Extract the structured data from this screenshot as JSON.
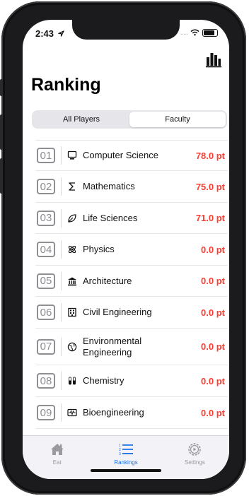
{
  "status": {
    "time": "2:43",
    "carrier": "....."
  },
  "header": {
    "title": "Ranking"
  },
  "tabs_segment": [
    {
      "label": "All Players",
      "selected": false
    },
    {
      "label": "Faculty",
      "selected": true
    }
  ],
  "rankings": [
    {
      "rank": "01",
      "icon": "computer-icon",
      "name": "Computer Science",
      "points": "78.0 pt"
    },
    {
      "rank": "02",
      "icon": "sigma-icon",
      "name": "Mathematics",
      "points": "75.0 pt"
    },
    {
      "rank": "03",
      "icon": "leaf-icon",
      "name": "Life Sciences",
      "points": "71.0 pt"
    },
    {
      "rank": "04",
      "icon": "atom-icon",
      "name": "Physics",
      "points": "0.0 pt"
    },
    {
      "rank": "05",
      "icon": "building-columns-icon",
      "name": "Architecture",
      "points": "0.0 pt"
    },
    {
      "rank": "06",
      "icon": "building-icon",
      "name": "Civil Engineering",
      "points": "0.0 pt"
    },
    {
      "rank": "07",
      "icon": "globe-icon",
      "name": "Environmental Engineering",
      "points": "0.0 pt"
    },
    {
      "rank": "08",
      "icon": "test-tubes-icon",
      "name": "Chemistry",
      "points": "0.0 pt"
    },
    {
      "rank": "09",
      "icon": "waveform-icon",
      "name": "Bioengineering",
      "points": "0.0 pt"
    }
  ],
  "tabbar": {
    "eat": {
      "label": "Eat",
      "icon": "house-icon"
    },
    "rankings": {
      "label": "Rankings",
      "icon": "list-numbered-icon"
    },
    "settings": {
      "label": "Settings",
      "icon": "gear-icon"
    }
  },
  "colors": {
    "accent": "#1a73e8",
    "points": "#ff3b30",
    "rank_border": "#8e8e93"
  }
}
